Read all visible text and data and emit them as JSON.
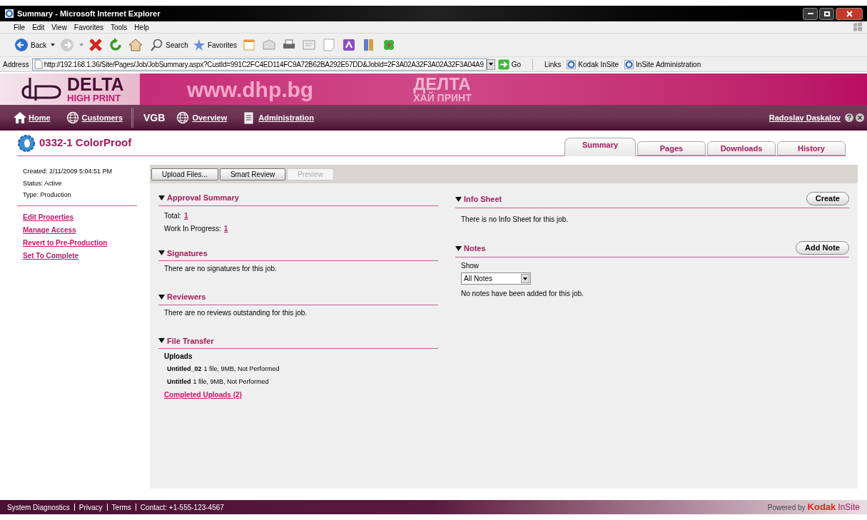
{
  "window": {
    "title": "Summary - Microsoft Internet Explorer"
  },
  "menu": [
    "File",
    "Edit",
    "View",
    "Favorites",
    "Tools",
    "Help"
  ],
  "toolbar": {
    "back": "Back",
    "search": "Search",
    "favorites": "Favorites"
  },
  "address": {
    "label": "Address",
    "url": "http://192.168.1.36/Site/Pages/Job/JobSummary.aspx?CustId=991C2FC4ED114FC9A72B62BA292E57DD&JobId=2F3A02A32F3A02A32F3A04A9",
    "go": "Go"
  },
  "links": {
    "label": "Links",
    "items": [
      "Kodak InSite",
      "InSite Administration"
    ]
  },
  "banner": {
    "brand": "DELTA",
    "brand_sub": "HIGH PRINT",
    "url": "www.dhp.bg",
    "brand_cyrillic": "ДЕЛТА",
    "brand_cyrillic_sub": "ХАЙ ПРИНТ"
  },
  "nav": [
    {
      "kind": "home",
      "label": "Home"
    },
    {
      "kind": "globe",
      "label": "Customers"
    },
    {
      "kind": "plain",
      "label": "VGB"
    },
    {
      "kind": "globe",
      "label": "Overview"
    },
    {
      "kind": "clipboard",
      "label": "Administration"
    }
  ],
  "user": "Radoslav Daskalov",
  "job": {
    "title": "0332-1 ColorProof"
  },
  "tabs": [
    {
      "label": "Summary",
      "selected": true
    },
    {
      "label": "Pages",
      "selected": false
    },
    {
      "label": "Downloads",
      "selected": false
    },
    {
      "label": "History",
      "selected": false
    }
  ],
  "details": [
    "Created: 2/11/2009 5:04:51 PM",
    "Status: Active",
    "Type: Production"
  ],
  "actions": [
    "Edit Properties",
    "Manage Access",
    "Revert to Pre-Production",
    "Set To Complete"
  ],
  "buttons": [
    {
      "label": "Upload Files...",
      "disabled": false
    },
    {
      "label": "Smart Review",
      "disabled": false
    },
    {
      "label": "Preview",
      "disabled": true
    }
  ],
  "approval_summary": {
    "title": "Approval Summary",
    "expanded": true,
    "rows": [
      {
        "label": "Total:",
        "value": "1"
      },
      {
        "label": "Work In Progress:",
        "value": "1"
      }
    ]
  },
  "signatures": {
    "title": "Signatures",
    "expanded": true,
    "message": "There are no signatures for this job."
  },
  "reviewers": {
    "title": "Reviewers",
    "expanded": true,
    "message": "There are no reviews outstanding for this job."
  },
  "file_transfer": {
    "title": "File Transfer",
    "expanded": true,
    "heading": "Uploads",
    "uploads": [
      {
        "name": "Untitled_02",
        "details": "1 file, 9MB, Not Performed"
      },
      {
        "name": "Untitled",
        "details": "1 file, 9MB, Not Performed"
      }
    ],
    "link": "Completed Uploads (2)"
  },
  "info_sheet": {
    "title": "Info Sheet",
    "expanded": true,
    "button": "Create",
    "message": "There is no Info Sheet for this job."
  },
  "notes": {
    "title": "Notes",
    "expanded": true,
    "button": "Add Note",
    "show_label": "Show",
    "filter": "All Notes",
    "message": "No notes have been added for this job."
  },
  "footer": {
    "links": [
      "System Diagnostics",
      "Privacy",
      "Terms",
      "Contact: +1-555-123-4567"
    ],
    "powered_by": "Powered by",
    "brand": "Kodak",
    "product": "InSite"
  }
}
